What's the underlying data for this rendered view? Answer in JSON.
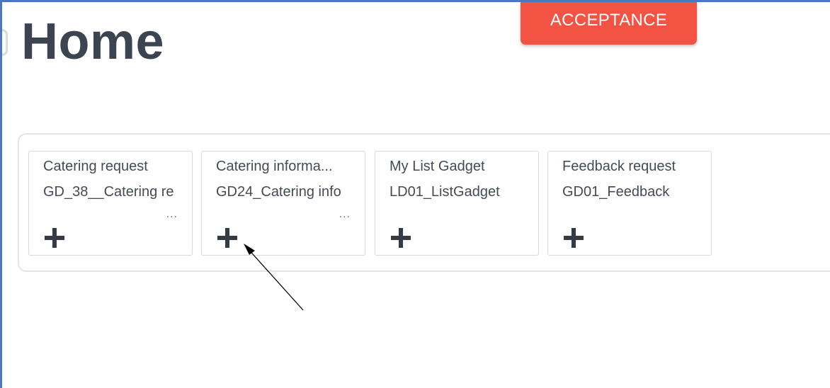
{
  "page": {
    "title": "Home"
  },
  "header": {
    "acceptance_label": "ACCEPTANCE",
    "acceptance_color": "#f25343"
  },
  "gadgets": [
    {
      "title": "Catering request",
      "code": "GD_38__Catering re",
      "more": "...",
      "add_icon": "plus-icon"
    },
    {
      "title": "Catering informa...",
      "code": "GD24_Catering info",
      "more": "...",
      "add_icon": "plus-icon"
    },
    {
      "title": "My List Gadget",
      "code": "LD01_ListGadget",
      "more": "",
      "add_icon": "plus-icon"
    },
    {
      "title": "Feedback request",
      "code": "GD01_Feedback",
      "more": "",
      "add_icon": "plus-icon"
    }
  ],
  "annotation": {
    "icon": "arrow-pointer",
    "target": "gadgets.1.add_icon"
  }
}
